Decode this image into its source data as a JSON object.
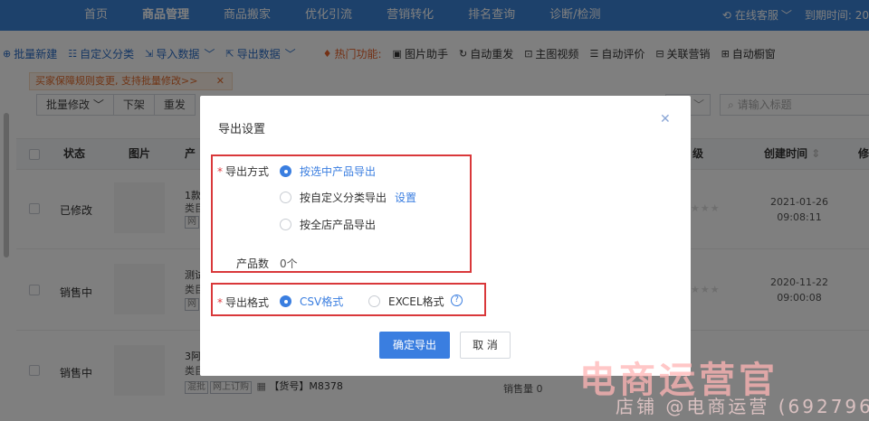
{
  "topnav": {
    "items": [
      "首页",
      "商品管理",
      "商品搬家",
      "优化引流",
      "营销转化",
      "排名查询",
      "诊断/检测"
    ],
    "active_index": 1,
    "online_service": "在线客服",
    "expire_label": "到期时间: 20"
  },
  "toolbar": {
    "batch_new": "批量新建",
    "custom_category": "自定义分类",
    "import_data": "导入数据",
    "export_data": "导出数据",
    "hot_features": "热门功能:",
    "image_helper": "图片助手",
    "auto_relist": "自动重发",
    "main_video": "主图视频",
    "auto_review": "自动评价",
    "related_marketing": "关联营销",
    "auto_window": "自动橱窗"
  },
  "notice": {
    "text": "买家保障规则变更, 支持批量修改>>"
  },
  "filter": {
    "buttons": [
      "批量修改",
      "下架",
      "重发"
    ],
    "search_placeholder": "请输入标题"
  },
  "table": {
    "headers": {
      "status": "状态",
      "image": "图片",
      "product": "产",
      "level": "级",
      "created": "创建时间",
      "extra": "修"
    },
    "rows": [
      {
        "status": "已修改",
        "title": "1款",
        "category": "类目",
        "tag": "网",
        "created_date": "2021-01-26",
        "created_time": "09:08:11"
      },
      {
        "status": "销售中",
        "title": "测试",
        "category": "类目",
        "tag": "网",
        "created_date": "2020-11-22",
        "created_time": "09:00:08"
      },
      {
        "status": "销售中",
        "title": "3阿",
        "category": "类目",
        "tag1": "混批",
        "tag2": "网上订购",
        "sku": "【货号】M8378",
        "sales": "销售量 0",
        "created_date": "",
        "created_time": ""
      }
    ]
  },
  "modal": {
    "title": "导出设置",
    "export_method_label": "导出方式",
    "options": [
      "按选中产品导出",
      "按自定义分类导出",
      "按全店产品导出"
    ],
    "selected_option": 0,
    "settings_link": "设置",
    "product_count_label": "产品数",
    "product_count_value": "0个",
    "format_label": "导出格式",
    "format_options": [
      "CSV格式",
      "EXCEL格式"
    ],
    "selected_format": 0,
    "confirm_label": "确定导出",
    "cancel_label": "取 消",
    "highlight_color": "#d9383a",
    "accent_color": "#3a7ee0"
  },
  "watermark": {
    "line1": "电商运营官",
    "line2": "店铺 @电商运营 (692796"
  }
}
